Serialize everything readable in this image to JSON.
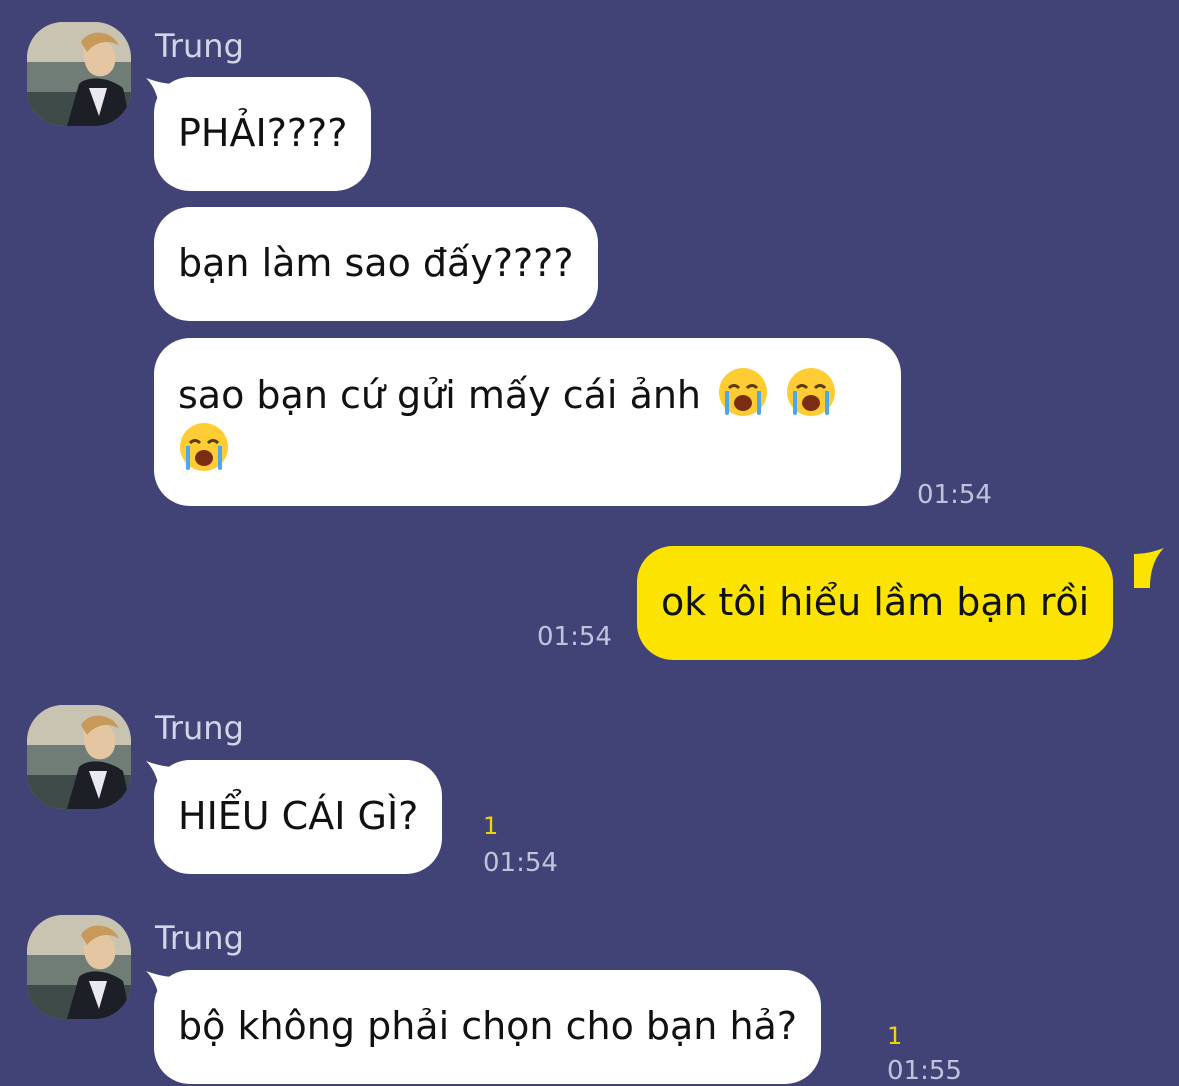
{
  "messages": [
    {
      "sender": "Trung",
      "avatar_icon": "user-photo-avatar",
      "bubbles": [
        "PHẢI????",
        "bạn làm sao đấy????",
        "sao bạn cứ gửi mấy cái ảnh"
      ],
      "emoji": [
        "loudly-crying-face-emoji",
        "loudly-crying-face-emoji",
        "loudly-crying-face-emoji"
      ],
      "time": "01:54"
    },
    {
      "sender": "me",
      "text": "ok tôi hiểu lầm bạn rồi",
      "time": "01:54"
    },
    {
      "sender": "Trung",
      "avatar_icon": "user-photo-avatar",
      "text": "HIỂU CÁI GÌ?",
      "unread": "1",
      "time": "01:54"
    },
    {
      "sender": "Trung",
      "avatar_icon": "user-photo-avatar",
      "text": "bộ không phải chọn cho bạn hả?",
      "unread": "1",
      "time": "01:55"
    }
  ],
  "colors": {
    "background": "#414376",
    "incoming_bubble": "#ffffff",
    "outgoing_bubble": "#fce400",
    "unread_count": "#f2d200",
    "timestamp": "#c2c3da"
  }
}
